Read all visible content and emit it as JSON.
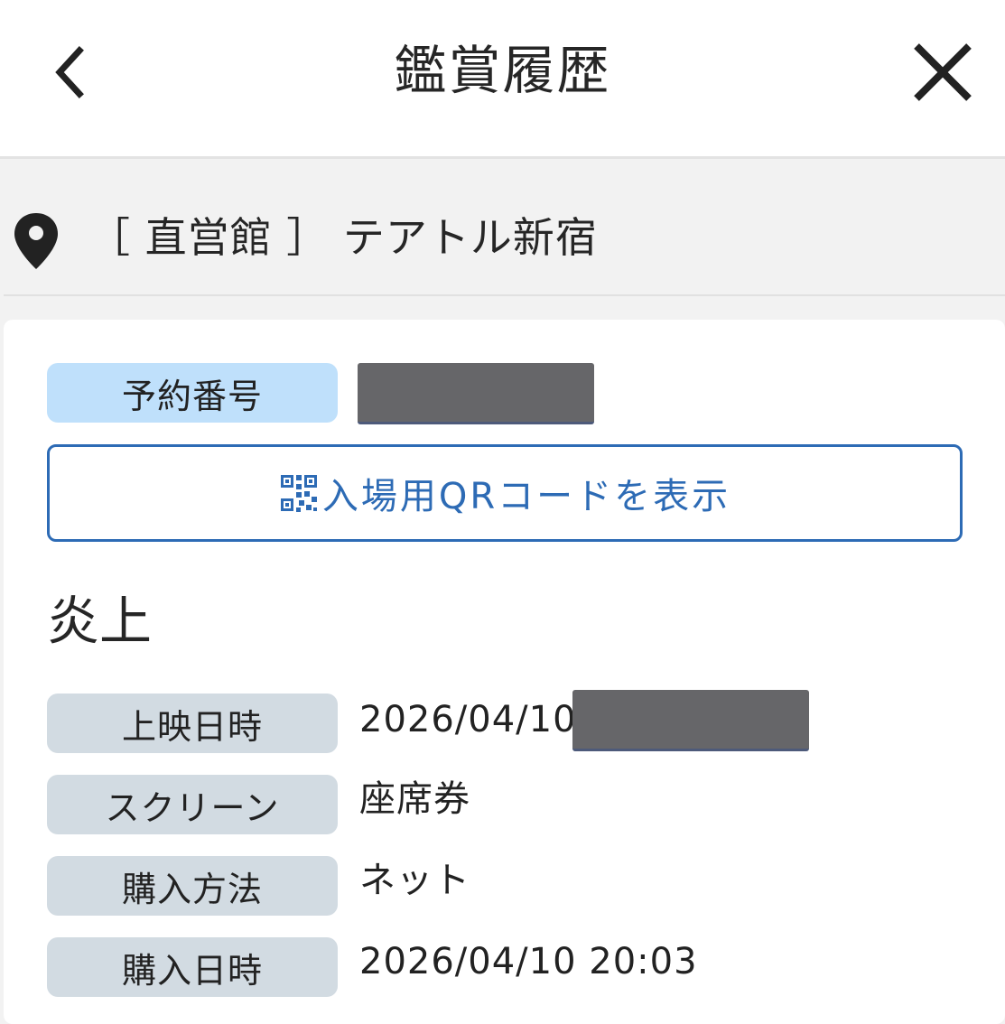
{
  "header": {
    "title": "鑑賞履歴",
    "back_icon": "chevron-left-icon",
    "close_icon": "close-icon"
  },
  "location": {
    "icon": "map-pin-icon",
    "name": "［ 直営館 ］ テアトル新宿"
  },
  "reservation": {
    "label": "予約番号",
    "value_redacted": true
  },
  "qr_button": {
    "icon": "qr-code-icon",
    "label": "入場用QRコードを表示"
  },
  "movie": {
    "title": "炎上"
  },
  "details": [
    {
      "label": "上映日時",
      "value": "2026/04/10"
    },
    {
      "label": "スクリーン",
      "value": "座席券"
    },
    {
      "label": "購入方法",
      "value": "ネット"
    },
    {
      "label": "購入日時",
      "value": "2026/04/10 20:03"
    }
  ],
  "colors": {
    "accent": "#2d6bb5",
    "label_blue": "#bfe0fb",
    "label_gray": "#d2dbe2",
    "redaction": "#666669"
  }
}
